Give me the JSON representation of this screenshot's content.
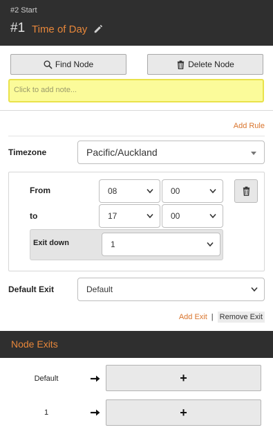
{
  "header": {
    "subtitle": "#2 Start",
    "number": "#1",
    "title": "Time of Day"
  },
  "toolbar": {
    "find_label": "Find Node",
    "delete_label": "Delete Node"
  },
  "note": {
    "placeholder": "Click to add note..."
  },
  "rules": {
    "add_rule_label": "Add Rule",
    "timezone_label": "Timezone",
    "timezone_value": "Pacific/Auckland",
    "rule": {
      "from_label": "From",
      "from_hour": "08",
      "from_minute": "00",
      "to_label": "to",
      "to_hour": "17",
      "to_minute": "00",
      "exit_label": "Exit down",
      "exit_value": "1"
    },
    "default_exit_label": "Default Exit",
    "default_exit_value": "Default",
    "add_exit_label": "Add Exit",
    "separator": "|",
    "remove_exit_label": "Remove Exit"
  },
  "node_exits": {
    "title": "Node Exits",
    "rows": [
      {
        "label": "Default",
        "button": "+"
      },
      {
        "label": "1",
        "button": "+"
      }
    ]
  },
  "colors": {
    "accent": "#e8873a",
    "dark_bar": "#2f2f2f",
    "note_bg": "#fbfb9a"
  }
}
